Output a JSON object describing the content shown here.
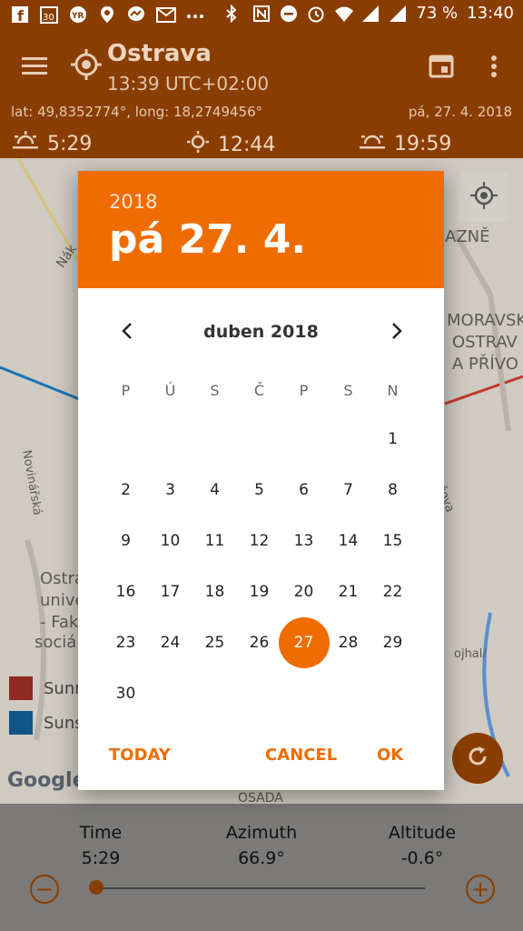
{
  "status_bar": {
    "battery": "73 %",
    "time": "13:40",
    "icons": [
      "facebook-icon",
      "calendar30-icon",
      "yr-icon",
      "location-icon",
      "messenger-icon",
      "gmail-icon",
      "more-icon",
      "bluetooth-icon",
      "nfc-icon",
      "dnd-icon",
      "alarm-icon",
      "wifi-icon",
      "signal-icon",
      "signal-icon"
    ]
  },
  "app_bar": {
    "title": "Ostrava",
    "subtitle": "13:39 UTC+02:00",
    "coords": "lat: 49,8352774°, long: 18,2749456°",
    "date": "pá, 27. 4. 2018",
    "sunrise": "5:29",
    "noon": "12:44",
    "sunset": "19:59"
  },
  "map": {
    "labels": [
      "Nák",
      "AZNĚ",
      "MORAVSK",
      "OSTRAV",
      "A PŘÍVO",
      "Novinářská",
      "Tyršova",
      "Ostra",
      "unive",
      "- Fak",
      "sociál",
      "OSADA",
      "ojhal/"
    ],
    "legend": [
      {
        "label": "Sunri",
        "color": "#c0392b"
      },
      {
        "label": "Suns",
        "color": "#1a73b5"
      }
    ],
    "google": "Google"
  },
  "bottom": {
    "time_label": "Time",
    "time_value": "5:29",
    "azimuth_label": "Azimuth",
    "azimuth_value": "66.9°",
    "altitude_label": "Altitude",
    "altitude_value": "-0.6°",
    "slider_fraction": 0.0
  },
  "dialog": {
    "year": "2018",
    "big_date": "pá 27. 4.",
    "month_label": "duben 2018",
    "weekdays": [
      "P",
      "Ú",
      "S",
      "Č",
      "P",
      "S",
      "N"
    ],
    "first_weekday_index": 6,
    "days_in_month": 30,
    "selected_day": 27,
    "actions": {
      "today": "TODAY",
      "cancel": "CANCEL",
      "ok": "OK"
    },
    "accent": "#ef6c00"
  }
}
